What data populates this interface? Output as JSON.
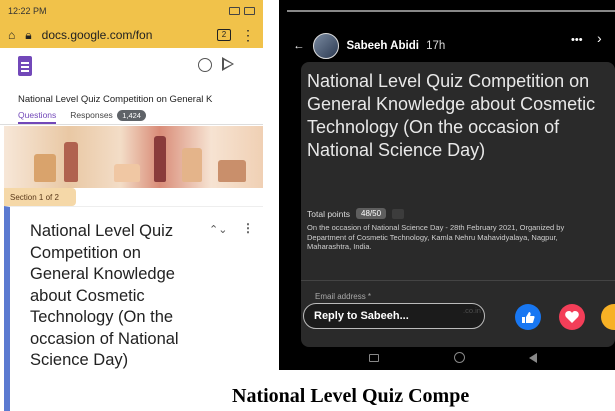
{
  "left_phone": {
    "status_time": "12:22 PM",
    "url": "docs.google.com/fon",
    "tabs_count": "2",
    "form_title": "National Level Quiz Competition on General K",
    "tabs": {
      "questions": "Questions",
      "responses": "Responses",
      "responses_count": "1,424"
    },
    "section_label": "Section 1 of 2",
    "card_title": "National Level Quiz Competition on General Knowledge about Cosmetic Technology (On the occasion of National Science Day)"
  },
  "right_phone": {
    "author": "Sabeeh Abidi",
    "time": "17h",
    "title": "National Level Quiz Competition on General Knowledge about Cosmetic Technology (On the occasion of National Science Day)",
    "total_points_label": "Total points",
    "total_points": "48/50",
    "description": "On the occasion of National Science Day - 28th February 2021, Organized by Department of Cosmetic Technology, Kamla Nehru Mahavidyalaya, Nagpur, Maharashtra, India.",
    "email_label": "Email address *",
    "email_value": ".co.in",
    "reply_placeholder": "Reply to Sabeeh..."
  },
  "caption": "National Level Quiz Compe",
  "colors": {
    "forms_purple": "#7248b9",
    "status_yellow": "#f1c24a",
    "fb_blue": "#1877f2",
    "love_red": "#f33e58"
  }
}
